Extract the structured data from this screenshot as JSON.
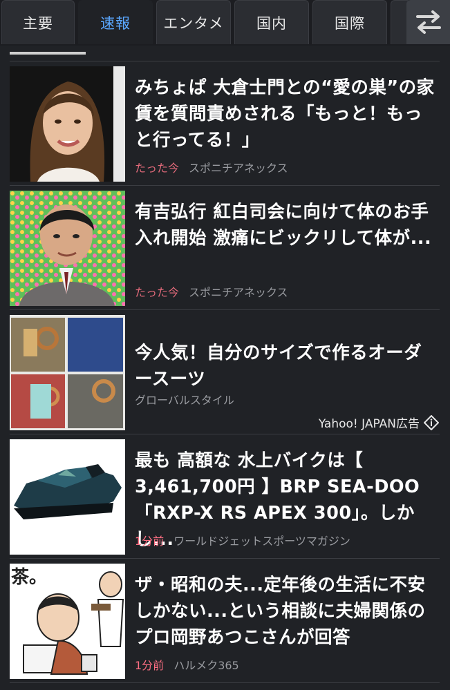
{
  "tabs": [
    {
      "label": "主要"
    },
    {
      "label": "速報"
    },
    {
      "label": "エンタメ"
    },
    {
      "label": "国内"
    },
    {
      "label": "国際"
    }
  ],
  "articles": [
    {
      "title": "みちょぱ 大倉士門との“愛の巣”の家賃を質問責めされる「もっと！もっと行ってる！」",
      "time": "たった今",
      "source": "スポニチアネックス"
    },
    {
      "title": "有吉弘行 紅白司会に向けて体のお手入れ開始 激痛にビックリして体が...",
      "time": "たった今",
      "source": "スポニチアネックス"
    },
    {
      "title": "今人気！自分のサイズで作るオーダースーツ",
      "source": "グローバルスタイル",
      "ad_label": "Yahoo! JAPAN広告"
    },
    {
      "title": "最も 高額な 水上バイクは【 3,461,700円 】BRP SEA-DOO「RXP-X RS APEX 300」。しかし...",
      "time": "1分前",
      "source": "ワールドジェットスポーツマガジン"
    },
    {
      "title": "ザ・昭和の夫...定年後の生活に不安しかない...という相談に夫婦関係のプロ岡野あつこさんが回答",
      "time": "1分前",
      "source": "ハルメク365"
    }
  ],
  "colors": {
    "background": "#202226",
    "tab_active": "#5aa7ff",
    "time_fresh": "#e26a7a",
    "meta": "#9a9ca1"
  }
}
